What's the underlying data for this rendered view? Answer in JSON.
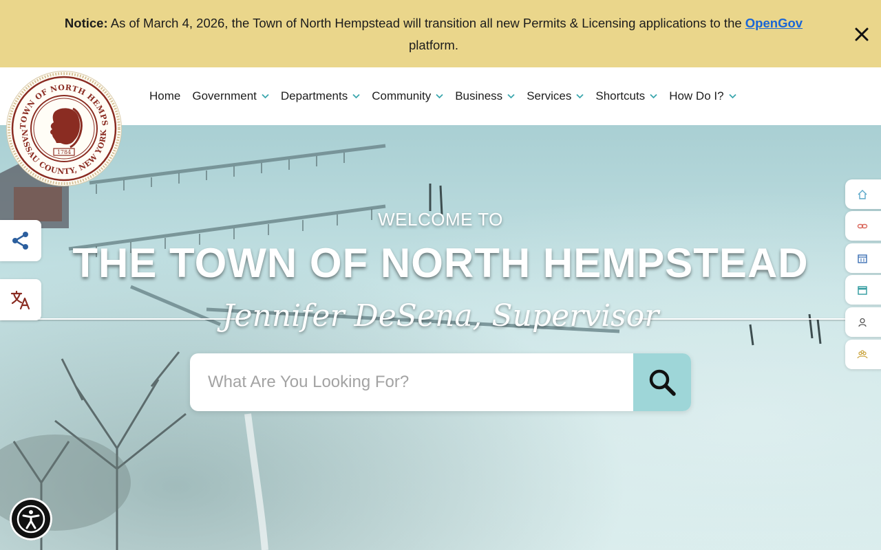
{
  "notice": {
    "label": "Notice:",
    "text_before": "As of March 4, 2026, the Town of North Hempstead will transition all new Permits & Licensing applications to the",
    "link": "OpenGov",
    "text_after": "platform."
  },
  "logo": {
    "top_text": "THE TOWN OF NORTH HEMPSTEAD",
    "bottom_text": "NASSAU COUNTY, NEW YORK",
    "year": "1784"
  },
  "nav": {
    "items": [
      {
        "label": "Home"
      },
      {
        "label": "Government"
      },
      {
        "label": "Departments"
      },
      {
        "label": "Community"
      },
      {
        "label": "Business"
      },
      {
        "label": "Services"
      },
      {
        "label": "Shortcuts"
      },
      {
        "label": "How Do I?"
      }
    ]
  },
  "hero": {
    "welcome": "WELCOME TO",
    "title": "THE TOWN OF NORTH HEMPSTEAD",
    "supervisor": "Jennifer DeSena, Supervisor"
  },
  "search": {
    "placeholder": "What Are You Looking For?"
  },
  "icons": {
    "share": "share-icon",
    "translate": "translate-icon",
    "accessibility": "accessibility-icon",
    "rail": [
      "home-icon",
      "link-icon",
      "calendar-grid-icon",
      "calendar-icon",
      "person-icon",
      "community-icon"
    ]
  },
  "colors": {
    "notice_bg": "#ead68b",
    "link": "#1a66d6",
    "search_button": "#9ed6d8",
    "seal": "#8a2c22"
  }
}
